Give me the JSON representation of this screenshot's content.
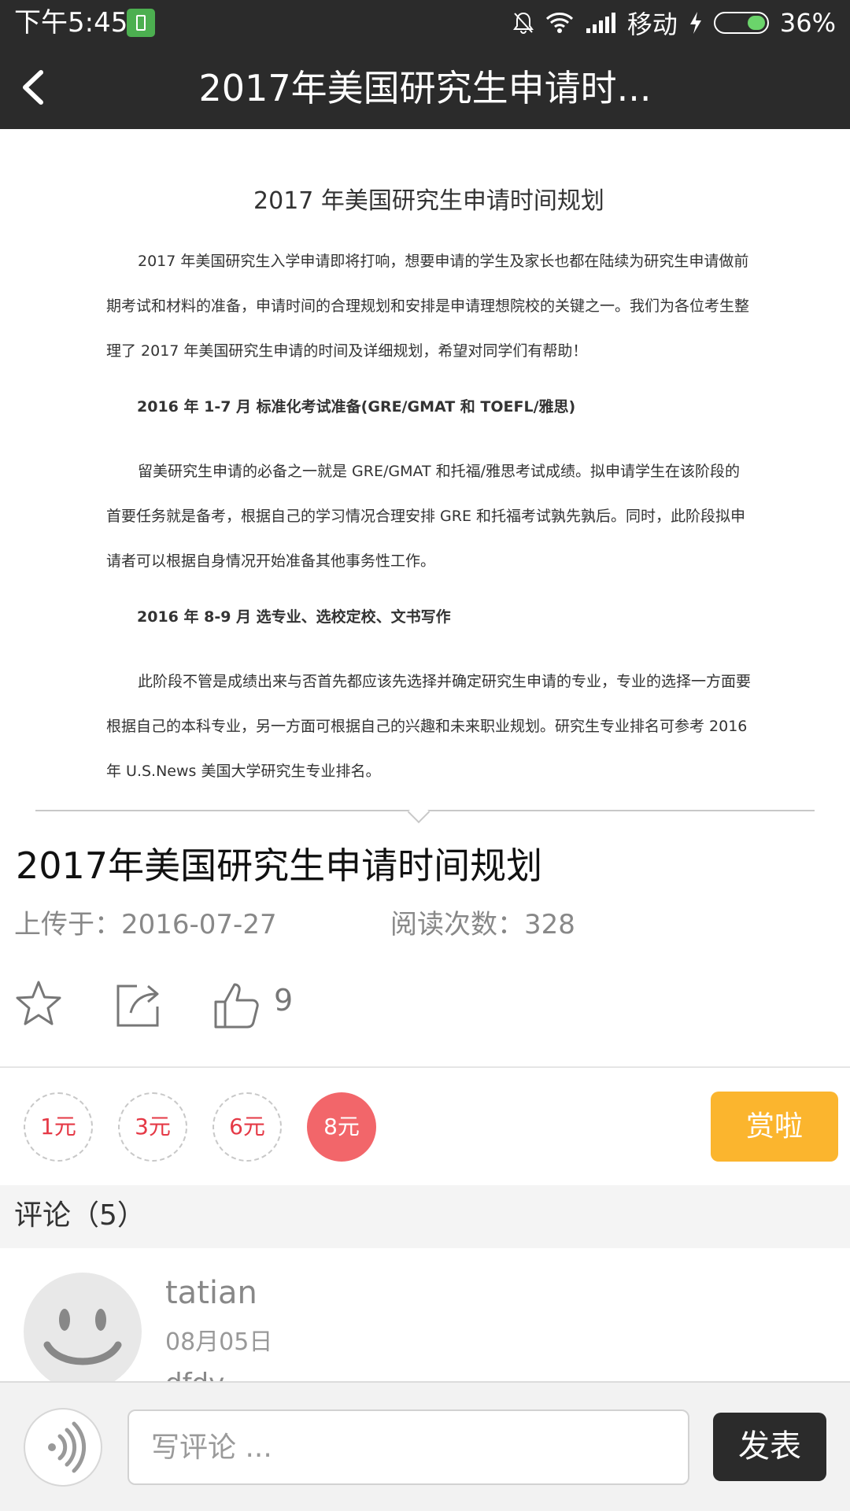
{
  "status_bar": {
    "time": "下午5:45",
    "carrier": "移动",
    "battery": "36%",
    "battery_level": 0.36,
    "icons": [
      "notification-icon",
      "bell-off-icon",
      "wifi-icon",
      "signal-icon",
      "charging-icon",
      "battery-icon"
    ]
  },
  "header": {
    "title": "2017年美国研究生申请时..."
  },
  "preview_doc": {
    "title": "2017 年美国研究生申请时间规划",
    "para1": "2017 年美国研究生入学申请即将打响，想要申请的学生及家长也都在陆续为研究生申请做前期考试和材料的准备，申请时间的合理规划和安排是申请理想院校的关键之一。我们为各位考生整理了 2017 年美国研究生申请的时间及详细规划，希望对同学们有帮助！",
    "heading1": "2016 年 1-7 月  标准化考试准备(GRE/GMAT 和 TOEFL/雅思)",
    "para2": "留美研究生申请的必备之一就是 GRE/GMAT 和托福/雅思考试成绩。拟申请学生在该阶段的首要任务就是备考，根据自己的学习情况合理安排 GRE 和托福考试孰先孰后。同时，此阶段拟申请者可以根据自身情况开始准备其他事务性工作。",
    "heading2": "2016 年 8-9 月  选专业、选校定校、文书写作",
    "para3": "此阶段不管是成绩出来与否首先都应该先选择并确定研究生申请的专业，专业的选择一方面要根据自己的本科专业，另一方面可根据自己的兴趣和未来职业规划。研究生专业排名可参考 2016 年 U.S.News 美国大学研究生专业排名。"
  },
  "article": {
    "title": "2017年美国研究生申请时间规划",
    "upload_label": "上传于：2016-07-27",
    "read_label": "阅读次数：328",
    "like_count": "9"
  },
  "tips": {
    "options": [
      "1元",
      "3元",
      "6元",
      "8元"
    ],
    "selected": "8元",
    "button": "赏啦",
    "accent": "#f2666a",
    "button_color": "#fbb52e"
  },
  "comments": {
    "header": "评论（5）",
    "items": [
      {
        "user": "tatian",
        "date": "08月05日",
        "text": "dfdv"
      }
    ]
  },
  "bottom_bar": {
    "placeholder": "写评论 ...",
    "send": "发表"
  }
}
